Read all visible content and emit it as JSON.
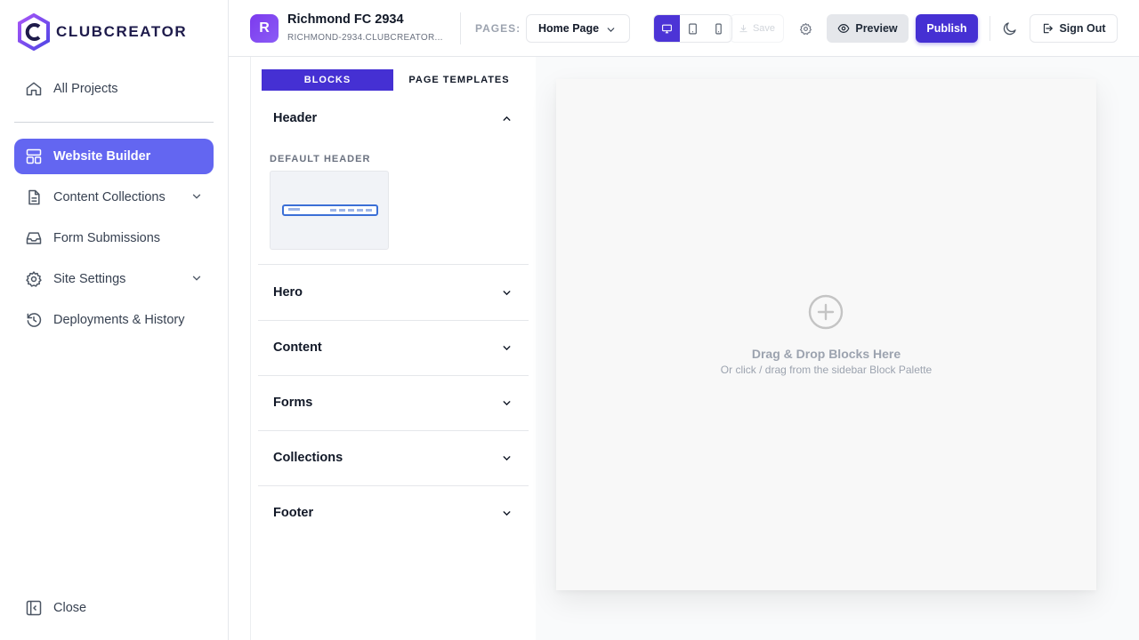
{
  "brand": {
    "name": "CLUBCREATOR",
    "accent": "#4530d3",
    "active_nav": "#6366f1"
  },
  "sidebar": {
    "items": [
      {
        "label": "All Projects",
        "icon": "home-icon"
      },
      {
        "label": "Website Builder",
        "icon": "layout-icon",
        "active": true
      },
      {
        "label": "Content Collections",
        "icon": "document-icon",
        "expandable": true
      },
      {
        "label": "Form Submissions",
        "icon": "inbox-icon"
      },
      {
        "label": "Site Settings",
        "icon": "gear-icon",
        "expandable": true
      },
      {
        "label": "Deployments & History",
        "icon": "history-icon"
      }
    ],
    "close_label": "Close"
  },
  "topbar": {
    "project_initial": "R",
    "project_name": "Richmond FC 2934",
    "project_domain": "RICHMOND-2934.CLUBCREATOR...",
    "pages_label": "PAGES:",
    "selected_page": "Home Page",
    "devices": [
      "desktop",
      "tablet",
      "mobile"
    ],
    "active_device": "desktop",
    "save_label": "Save",
    "preview_label": "Preview",
    "publish_label": "Publish",
    "signout_label": "Sign Out"
  },
  "palette": {
    "tabs": [
      "BLOCKS",
      "PAGE TEMPLATES"
    ],
    "active_tab": "BLOCKS",
    "sections": [
      {
        "label": "Header",
        "expanded": true,
        "block_group_label": "DEFAULT HEADER"
      },
      {
        "label": "Hero",
        "expanded": false
      },
      {
        "label": "Content",
        "expanded": false
      },
      {
        "label": "Forms",
        "expanded": false
      },
      {
        "label": "Collections",
        "expanded": false
      },
      {
        "label": "Footer",
        "expanded": false
      }
    ]
  },
  "canvas": {
    "drop_title": "Drag & Drop Blocks Here",
    "drop_subtitle": "Or click / drag from the sidebar Block Palette"
  }
}
